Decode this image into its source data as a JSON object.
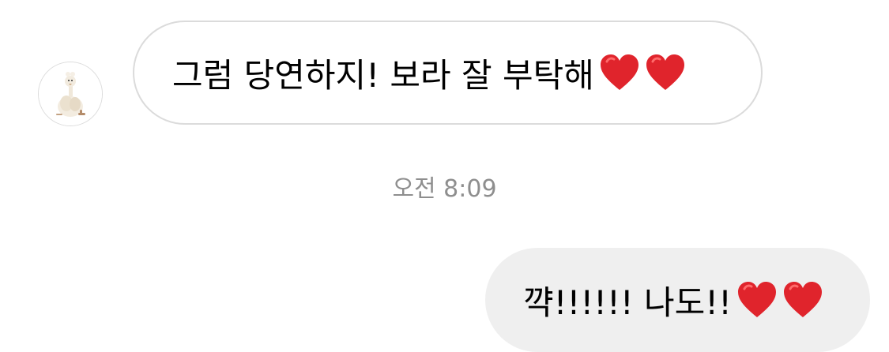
{
  "conversation": {
    "incoming_message": {
      "text": "그럼 당연하지! 보라 잘 부탁해",
      "emoji": [
        "red-heart",
        "red-heart"
      ],
      "sender_avatar": "plush-bird-avatar"
    },
    "timestamp": "오전 8:09",
    "outgoing_message": {
      "text": "꺅!!!!!! 나도!!",
      "emoji": [
        "red-heart",
        "red-heart"
      ]
    }
  },
  "colors": {
    "incoming_bubble_border": "#dbdbdb",
    "outgoing_bubble_bg": "#efefef",
    "timestamp_text": "#8e8e8e",
    "heart": "#e0242c"
  }
}
